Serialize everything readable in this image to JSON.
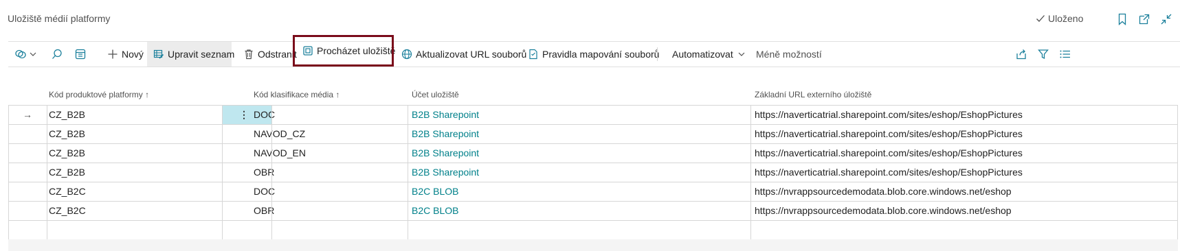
{
  "header": {
    "title": "Uložiště médií platformy",
    "saved_label": "Uloženo"
  },
  "toolbar": {
    "new_label": "Nový",
    "edit_list_label": "Upravit seznam",
    "delete_label": "Odstranit",
    "browse_storage_label": "Procházet uložiště",
    "update_urls_label": "Aktualizovat URL souborů",
    "mapping_rules_label": "Pravidla mapování souborů",
    "automate_label": "Automatizovat",
    "fewer_options_label": "Méně možností"
  },
  "table": {
    "columns": [
      "Kód produktové platformy",
      "Kód klasifikace média",
      "Účet uložiště",
      "Základní URL externího úložiště"
    ],
    "rows": [
      {
        "platform": "CZ_B2B",
        "classification": "DOC",
        "account": "B2B Sharepoint",
        "url": "https://naverticatrial.sharepoint.com/sites/eshop/EshopPictures"
      },
      {
        "platform": "CZ_B2B",
        "classification": "NAVOD_CZ",
        "account": "B2B Sharepoint",
        "url": "https://naverticatrial.sharepoint.com/sites/eshop/EshopPictures"
      },
      {
        "platform": "CZ_B2B",
        "classification": "NAVOD_EN",
        "account": "B2B Sharepoint",
        "url": "https://naverticatrial.sharepoint.com/sites/eshop/EshopPictures"
      },
      {
        "platform": "CZ_B2B",
        "classification": "OBR",
        "account": "B2B Sharepoint",
        "url": "https://naverticatrial.sharepoint.com/sites/eshop/EshopPictures"
      },
      {
        "platform": "CZ_B2C",
        "classification": "DOC",
        "account": "B2C BLOB",
        "url": "https://nvrappsourcedemodata.blob.core.windows.net/eshop"
      },
      {
        "platform": "CZ_B2C",
        "classification": "OBR",
        "account": "B2C BLOB",
        "url": "https://nvrappsourcedemodata.blob.core.windows.net/eshop"
      }
    ]
  },
  "colors": {
    "link": "#00808a",
    "highlight_border": "#7a0b1a",
    "selected_cell": "#bfe7ef"
  }
}
